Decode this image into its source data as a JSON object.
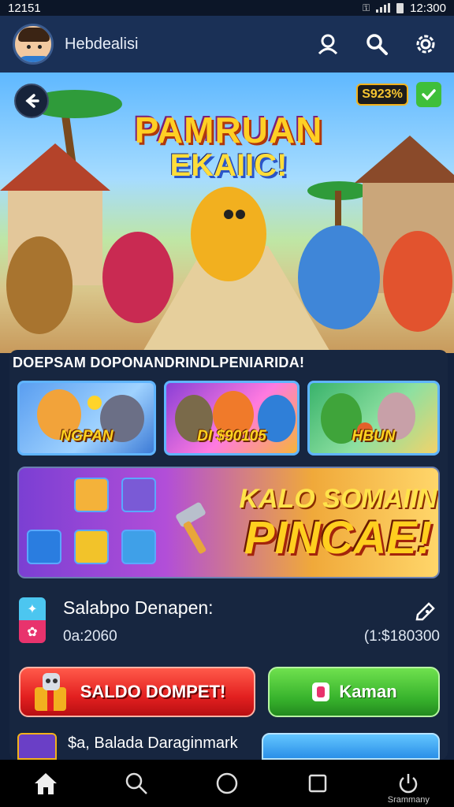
{
  "status_bar": {
    "time": "12151",
    "clock": "12:300"
  },
  "header": {
    "username": "Hebdealisi"
  },
  "hero": {
    "title_line1": "PAMRUAN",
    "title_line2": "EKAIIC!",
    "coin_badge": "S923%"
  },
  "section": {
    "label": "DOEPSAM DOPONANDRINDLPENIARIDA!"
  },
  "cards": [
    {
      "label": "NGPAN"
    },
    {
      "label": "DI $90105"
    },
    {
      "label": "HBUN"
    }
  ],
  "promo": {
    "line1": "KALO SOMAIIN",
    "line2": "PINCAE!"
  },
  "wallet": {
    "title": "Salabpo Denapen:",
    "left_value": "0a:2060",
    "right_value": "(1:$180300"
  },
  "actions": {
    "primary_label": "SALDO DOMPET!",
    "secondary_label": "Kaman"
  },
  "partial_row": {
    "text": "$a, Balada Daraginmark"
  },
  "navbar": {
    "caption": "Srammany"
  },
  "colors": {
    "header_bg": "#1a3056",
    "panel_bg": "#172640",
    "accent_gold": "#ffcf24",
    "primary_red": "#e32020",
    "secondary_green": "#37b22c"
  }
}
